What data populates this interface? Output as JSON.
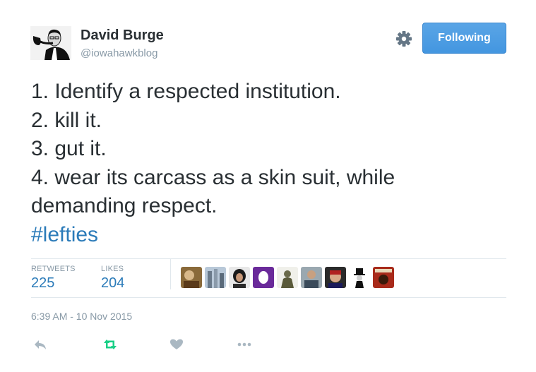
{
  "author": {
    "display_name": "David Burge",
    "screen_name": "@iowahawkblog"
  },
  "follow_button": {
    "label": "Following"
  },
  "tweet": {
    "lines": [
      "1. Identify a respected institution.",
      "2. kill it.",
      "3. gut it.",
      "4. wear its carcass as a skin suit, while",
      "demanding respect."
    ],
    "hashtag": "#lefties"
  },
  "stats": {
    "retweets_label": "RETWEETS",
    "retweets_count": "225",
    "likes_label": "LIKES",
    "likes_count": "204"
  },
  "liker_avatars": 9,
  "timestamp": "6:39 AM - 10 Nov 2015",
  "icons": [
    "gear-icon",
    "reply-icon",
    "retweet-icon",
    "like-icon",
    "more-icon"
  ],
  "colors": {
    "accent": "#2b7bb9",
    "button": "#4a9ae1",
    "retweet_green": "#19cf86",
    "muted": "#8899a6"
  }
}
